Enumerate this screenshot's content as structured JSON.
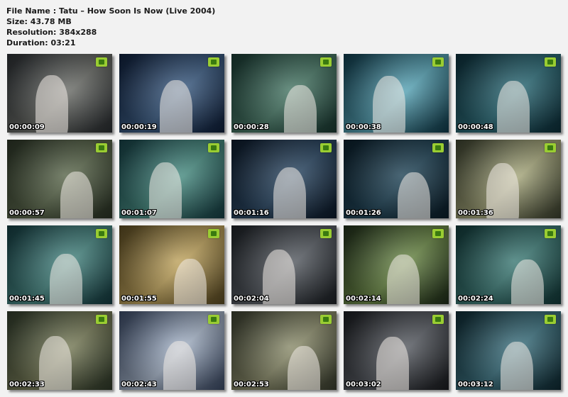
{
  "info": {
    "file_name": "File Name : Tatu – How Soon Is Now (Live 2004)",
    "size": "Size:  43.78 MB",
    "resolution": "Resolution: 384x288",
    "duration": "Duration: 03:21"
  },
  "thumbnails": [
    {
      "time": "00:00:09",
      "colors": [
        "#2a2e32",
        "#6d6f6a"
      ]
    },
    {
      "time": "00:00:19",
      "colors": [
        "#0f1f3a",
        "#3e5f86"
      ]
    },
    {
      "time": "00:00:28",
      "colors": [
        "#1a3a33",
        "#4a7a68"
      ]
    },
    {
      "time": "00:00:38",
      "colors": [
        "#0f3a4a",
        "#5aa7b9"
      ]
    },
    {
      "time": "00:00:48",
      "colors": [
        "#0d2f3a",
        "#2e6e7a"
      ]
    },
    {
      "time": "00:00:57",
      "colors": [
        "#2b3426",
        "#5d6a4e"
      ]
    },
    {
      "time": "00:01:07",
      "colors": [
        "#163f45",
        "#4a8f84"
      ]
    },
    {
      "time": "00:01:16",
      "colors": [
        "#0d1a2a",
        "#2d4a66"
      ]
    },
    {
      "time": "00:01:26",
      "colors": [
        "#0b1e2a",
        "#23475a"
      ]
    },
    {
      "time": "00:01:36",
      "colors": [
        "#3a3f2e",
        "#a9aa7e"
      ]
    },
    {
      "time": "00:01:45",
      "colors": [
        "#143b40",
        "#4a8a85"
      ]
    },
    {
      "time": "00:01:55",
      "colors": [
        "#5a4a22",
        "#c3a760"
      ]
    },
    {
      "time": "00:02:04",
      "colors": [
        "#1d2126",
        "#5a5f66"
      ]
    },
    {
      "time": "00:02:14",
      "colors": [
        "#1f2d1a",
        "#6f8d4a"
      ]
    },
    {
      "time": "00:02:24",
      "colors": [
        "#123a3a",
        "#3f7d78"
      ]
    },
    {
      "time": "00:02:33",
      "colors": [
        "#2f3a2a",
        "#7a7e5a"
      ]
    },
    {
      "time": "00:02:43",
      "colors": [
        "#3b4a66",
        "#aab8cc"
      ]
    },
    {
      "time": "00:02:53",
      "colors": [
        "#3a3e2f",
        "#8e8f6e"
      ]
    },
    {
      "time": "00:03:02",
      "colors": [
        "#1a1c20",
        "#5b5f66"
      ]
    },
    {
      "time": "00:03:12",
      "colors": [
        "#0f2a33",
        "#3e7482"
      ]
    }
  ]
}
